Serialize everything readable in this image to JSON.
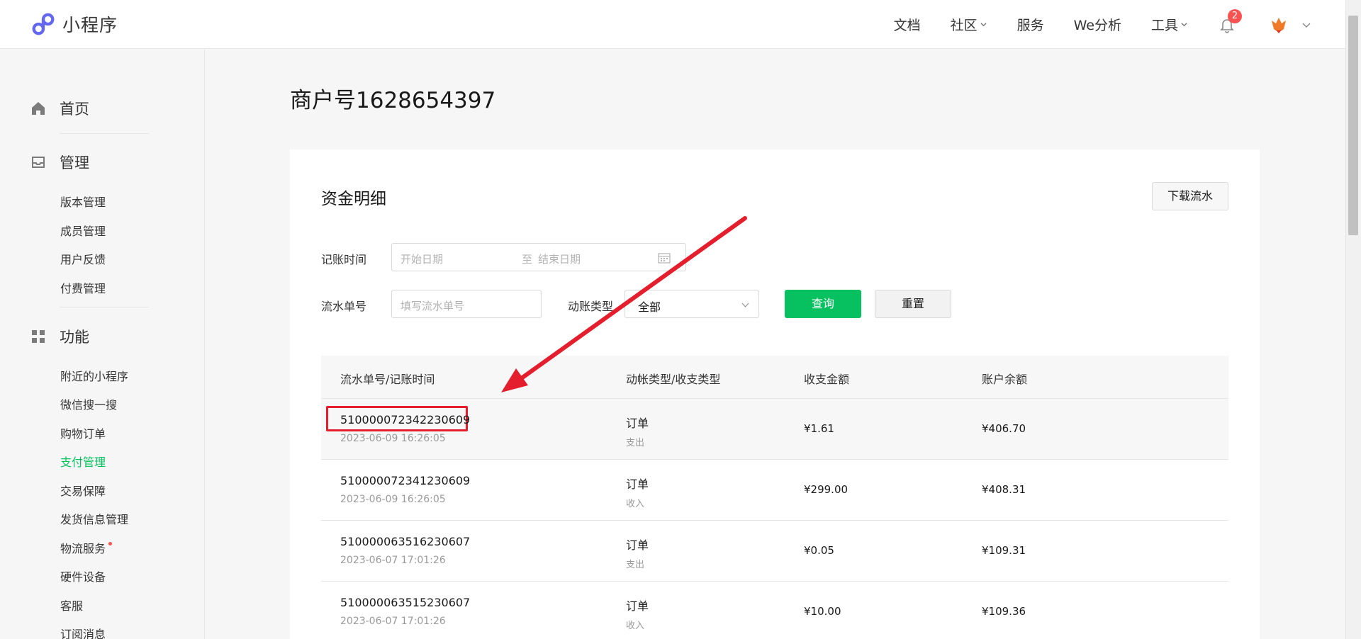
{
  "app": {
    "title": "小程序"
  },
  "topnav": {
    "items": [
      "文档",
      "社区",
      "服务",
      "We分析",
      "工具"
    ],
    "notification_count": "2"
  },
  "sidebar": {
    "home": "首页",
    "manage": "管理",
    "manage_items": [
      "版本管理",
      "成员管理",
      "用户反馈",
      "付费管理"
    ],
    "features": "功能",
    "feature_items": [
      "附近的小程序",
      "微信搜一搜",
      "购物订单",
      "支付管理",
      "交易保障",
      "发货信息管理",
      "物流服务",
      "硬件设备",
      "客服",
      "订阅消息"
    ]
  },
  "page": {
    "title": "商户号1628654397"
  },
  "card": {
    "title": "资金明细",
    "download_label": "下载流水"
  },
  "filters": {
    "date_label": "记账时间",
    "start_placeholder": "开始日期",
    "to": "至",
    "end_placeholder": "结束日期",
    "serial_label": "流水单号",
    "serial_placeholder": "填写流水单号",
    "type_label": "动账类型",
    "type_value": "全部",
    "query_label": "查询",
    "reset_label": "重置"
  },
  "table": {
    "headers": [
      "流水单号/记账时间",
      "动帐类型/收支类型",
      "收支金额",
      "账户余额"
    ],
    "rows": [
      {
        "id": "510000072342230609",
        "time": "2023-06-09 16:26:05",
        "type": "订单",
        "direction": "支出",
        "amount": "¥1.61",
        "balance": "¥406.70"
      },
      {
        "id": "510000072341230609",
        "time": "2023-06-09 16:26:05",
        "type": "订单",
        "direction": "收入",
        "amount": "¥299.00",
        "balance": "¥408.31"
      },
      {
        "id": "510000063516230607",
        "time": "2023-06-07 17:01:26",
        "type": "订单",
        "direction": "支出",
        "amount": "¥0.05",
        "balance": "¥109.31"
      },
      {
        "id": "510000063515230607",
        "time": "2023-06-07 17:01:26",
        "type": "订单",
        "direction": "收入",
        "amount": "¥10.00",
        "balance": "¥109.36"
      }
    ]
  },
  "colors": {
    "accent": "#07c160",
    "annotation": "#e41e2c",
    "badge": "#fa5151"
  }
}
